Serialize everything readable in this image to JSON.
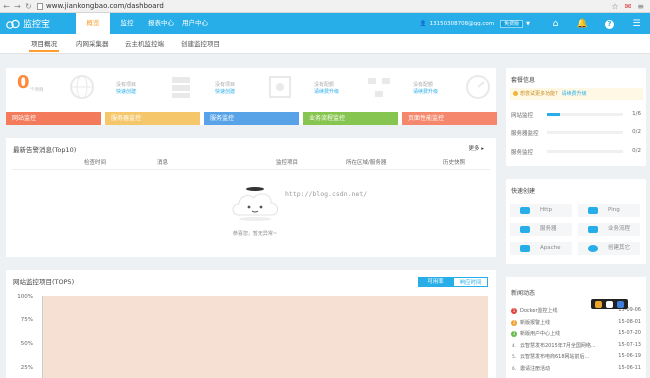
{
  "browser": {
    "url": "www.jiankongbao.com/dashboard"
  },
  "header": {
    "logo_text": "监控宝",
    "nav": [
      "概览",
      "监控",
      "报表中心",
      "用户中心"
    ],
    "email": "13150308708@qq.com",
    "plan_badge": "免费版"
  },
  "subnav": [
    "项目概况",
    "内网采集器",
    "云主机监控端",
    "创建监控项目"
  ],
  "cards": [
    {
      "big": "0",
      "big_sub": "个项目",
      "line1": "",
      "line2": "",
      "footer": "网站监控",
      "color": "#f37a5a"
    },
    {
      "big": "",
      "big_sub": "",
      "line1": "没有项目",
      "line2": "快速创建",
      "footer": "服务器监控",
      "color": "#f5c66a"
    },
    {
      "big": "",
      "big_sub": "",
      "line1": "没有项目",
      "line2": "快速创建",
      "footer": "服务监控",
      "color": "#58a3e8"
    },
    {
      "big": "",
      "big_sub": "",
      "line1": "没有配额",
      "line2": "请续费升级",
      "footer": "业务流程监控",
      "color": "#86c54f"
    },
    {
      "big": "",
      "big_sub": "",
      "line1": "没有配额",
      "line2": "请续费升级",
      "footer": "页面性能监控",
      "color": "#f5876c"
    }
  ],
  "alerts": {
    "title": "最新告警消息(Top10)",
    "more": "更多 ▸",
    "columns": [
      "检查时间",
      "消息",
      "监控项目",
      "所在区域/服务器",
      "历史快照"
    ],
    "empty_text": "恭喜您，暂无异常~",
    "watermark": "http://blog.csdn.net/"
  },
  "top5": {
    "title": "网站监控项目(TOP5)",
    "tab_on": "可用率",
    "tab_off": "响应时间",
    "y_ticks": [
      "100%",
      "75%",
      "50%",
      "25%"
    ]
  },
  "package": {
    "title": "套餐信息",
    "tip": "想尝试更多功能?",
    "tip_link": "请续费升级",
    "rows": [
      {
        "label": "网站监控",
        "value": "1/6",
        "fraction": 0.17
      },
      {
        "label": "服务器监控",
        "value": "0/2",
        "fraction": 0
      },
      {
        "label": "服务监控",
        "value": "0/2",
        "fraction": 0
      }
    ]
  },
  "quick": {
    "title": "快速创建",
    "buttons": [
      "Http",
      "Ping",
      "服务器",
      "业务流程",
      "Apache",
      "创建其它"
    ]
  },
  "news": {
    "title": "新闻动态",
    "items": [
      {
        "n": "1",
        "text": "Docker监控上线",
        "date": "15-09-06",
        "color": "#e0433c"
      },
      {
        "n": "2",
        "text": "新版报警上线",
        "date": "15-08-01",
        "color": "#f0a030"
      },
      {
        "n": "3",
        "text": "新版用户中心上线",
        "date": "15-07-20",
        "color": "#68b84a"
      },
      {
        "n": "4.",
        "text": "云智慧发布2015年7月全国网络...",
        "date": "15-07-13",
        "color": ""
      },
      {
        "n": "5.",
        "text": "云智慧发布电商618网站前后...",
        "date": "15-06-19",
        "color": ""
      },
      {
        "n": "6.",
        "text": "邀请注册活动",
        "date": "15-06-11",
        "color": ""
      }
    ]
  }
}
